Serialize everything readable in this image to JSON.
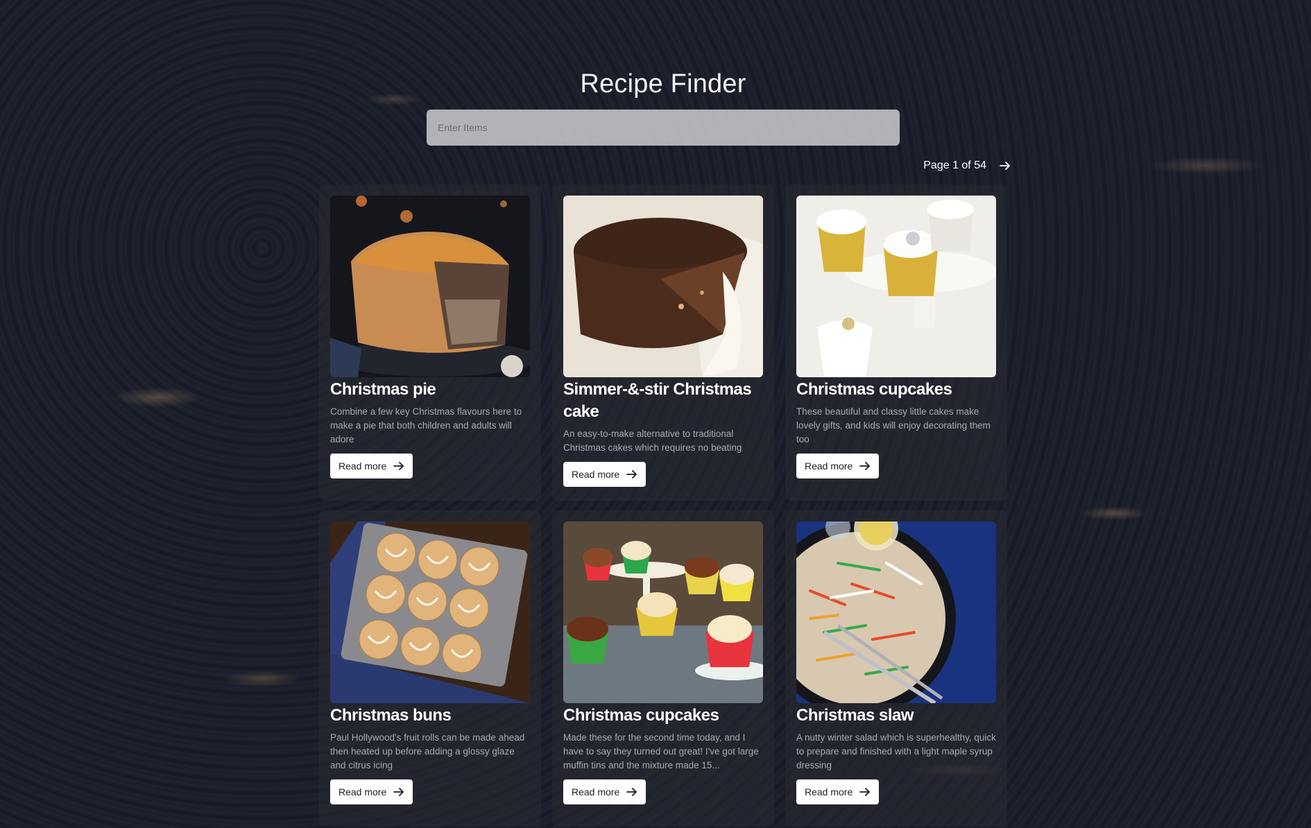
{
  "header": {
    "title": "Recipe Finder"
  },
  "search": {
    "placeholder": "Enter Items",
    "value": ""
  },
  "pagination": {
    "label": "Page 1 of 54",
    "next_icon": "arrow-right-icon"
  },
  "recipes": [
    {
      "title": "Christmas pie",
      "description": "Combine a few key Christmas flavours here to make a pie that both children and adults will adore",
      "button": "Read more",
      "image": "christmas-pie-photo"
    },
    {
      "title": "Simmer-&-stir Christmas cake",
      "description": "An easy-to-make alternative to traditional Christmas cakes which requires no beating",
      "button": "Read more",
      "image": "christmas-cake-photo"
    },
    {
      "title": "Christmas cupcakes",
      "description": "These beautiful and classy little cakes make lovely gifts, and kids will enjoy decorating them too",
      "button": "Read more",
      "image": "white-cupcakes-photo"
    },
    {
      "title": "Christmas buns",
      "description": "Paul Hollywood's fruit rolls can be made ahead then heated up before adding a glossy glaze and citrus icing",
      "button": "Read more",
      "image": "christmas-buns-photo"
    },
    {
      "title": "Christmas cupcakes",
      "description": "Made these for the second time today, and I have to say they turned out great! I've got large muffin tins and the mixture made 15...",
      "button": "Read more",
      "image": "colorful-cupcakes-photo"
    },
    {
      "title": "Christmas slaw",
      "description": "A nutty winter salad which is superhealthy, quick to prepare and finished with a light maple syrup dressing",
      "button": "Read more",
      "image": "christmas-slaw-photo"
    }
  ],
  "colors": {
    "background": "#14161d",
    "card": "#282a32",
    "marble_vein": "#b8946c",
    "button_bg": "#ffffff"
  }
}
